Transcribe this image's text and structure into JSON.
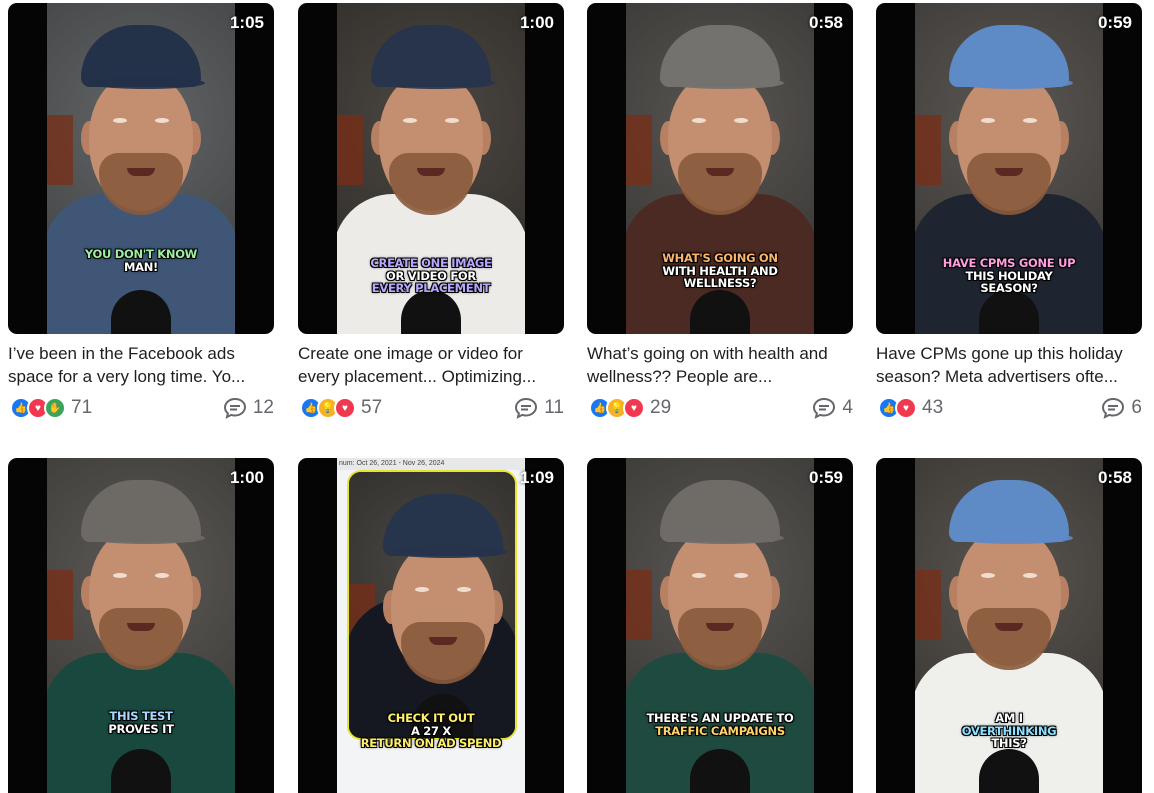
{
  "videos": [
    {
      "duration": "1:05",
      "caption": [
        "YOU DON'T KNOW",
        "MAN!"
      ],
      "caption_colors": [
        "#9ef0a0",
        "#ffffff"
      ],
      "title": "I’ve been in the Facebook ads space for a very long time. Yo...",
      "reaction_icons": [
        "like-icon",
        "love-icon",
        "celebrate-icon"
      ],
      "reactions": "71",
      "comments": "12",
      "cap_color": "#233149",
      "shirt_color": "#3f5676",
      "wall_color": "#55585a"
    },
    {
      "duration": "1:00",
      "caption": [
        "CREATE ONE IMAGE",
        "OR VIDEO FOR",
        "EVERY PLACEMENT"
      ],
      "caption_colors": [
        "#b8a7ff",
        "#ffffff",
        "#b8a7ff"
      ],
      "title": "Create one image or video for every placement... Optimizing...",
      "reaction_icons": [
        "like-icon",
        "insightful-icon",
        "love-icon"
      ],
      "reactions": "57",
      "comments": "11",
      "cap_color": "#27344c",
      "shirt_color": "#ecebe8",
      "wall_color": "#3d3832"
    },
    {
      "duration": "0:58",
      "caption": [
        "WHAT'S GOING ON",
        "WITH HEALTH AND",
        "WELLNESS?"
      ],
      "caption_colors": [
        "#ffb36a",
        "#ffffff",
        "#ffffff"
      ],
      "title": "What’s going on with health and wellness?? People are...",
      "reaction_icons": [
        "like-icon",
        "insightful-icon",
        "love-icon"
      ],
      "reactions": "29",
      "comments": "4",
      "cap_color": "#74726f",
      "shirt_color": "#4a2a22",
      "wall_color": "#4a4744"
    },
    {
      "duration": "0:59",
      "caption": [
        "HAVE CPMS GONE UP",
        "THIS HOLIDAY",
        "SEASON?"
      ],
      "caption_colors": [
        "#ff9ee0",
        "#ffffff",
        "#ffffff"
      ],
      "title": "Have CPMs gone up this holiday season? Meta advertisers ofte...",
      "reaction_icons": [
        "like-icon",
        "love-icon"
      ],
      "reactions": "43",
      "comments": "6",
      "cap_color": "#5e8ac6",
      "shirt_color": "#1e2530",
      "wall_color": "#4d4945"
    },
    {
      "duration": "1:00",
      "caption": [
        "THIS TEST",
        "PROVES IT"
      ],
      "caption_colors": [
        "#a9d8ff",
        "#ffffff"
      ],
      "cap_color": "#6d6a66",
      "shirt_color": "#19483f",
      "wall_color": "#4e4b47"
    },
    {
      "duration": "1:09",
      "caption": [
        "CHECK IT OUT",
        "A 27 X",
        "RETURN ON AD SPEND"
      ],
      "caption_colors": [
        "#ffef6b",
        "#ffffff",
        "#ffef6b"
      ],
      "screen_text": "num: Oct 26, 2021 - Nov 26, 2024",
      "cap_color": "#26344c",
      "shirt_color": "#151820",
      "wall_color": "#3b3834"
    },
    {
      "duration": "0:59",
      "caption": [
        "THERE'S AN UPDATE TO",
        "TRAFFIC CAMPAIGNS"
      ],
      "caption_colors": [
        "#ffffff",
        "#ffd36a"
      ],
      "cap_color": "#6f6c68",
      "shirt_color": "#1f4a40",
      "wall_color": "#4b4844"
    },
    {
      "duration": "0:58",
      "caption": [
        "AM I",
        "OVERTHINKING",
        "THIS?"
      ],
      "caption_colors": [
        "#ffffff",
        "#8ee0ff",
        "#ffffff"
      ],
      "cap_color": "#5e8ac6",
      "shirt_color": "#efefec",
      "wall_color": "#4a4641"
    }
  ]
}
